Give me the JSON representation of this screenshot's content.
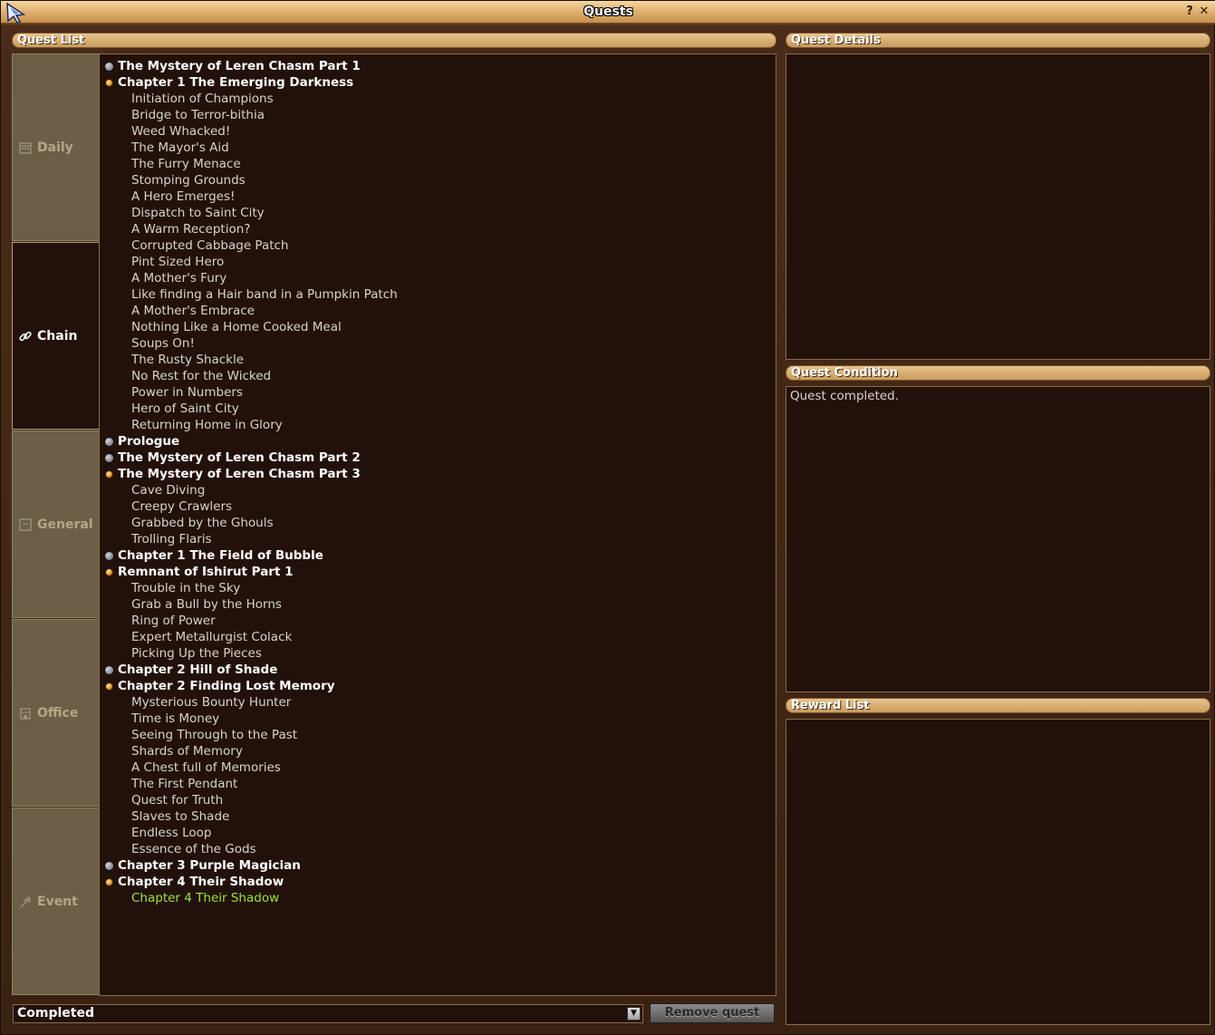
{
  "window": {
    "title": "Quests"
  },
  "sections": {
    "quest_list": "Quest List",
    "quest_details": "Quest Details",
    "quest_condition": "Quest Condition",
    "reward_list": "Reward List"
  },
  "tabs": [
    {
      "label": "Daily",
      "icon": "calendar-icon",
      "active": false
    },
    {
      "label": "Chain",
      "icon": "chain-link-icon",
      "active": true
    },
    {
      "label": "General",
      "icon": "square-icon",
      "active": false
    },
    {
      "label": "Office",
      "icon": "building-icon",
      "active": false
    },
    {
      "label": "Event",
      "icon": "flag-icon",
      "active": false
    }
  ],
  "quest_rows": [
    {
      "type": "group",
      "bullet": "grey",
      "text": "The Mystery of Leren Chasm Part 1"
    },
    {
      "type": "group",
      "bullet": "orange",
      "text": "Chapter 1 The Emerging Darkness"
    },
    {
      "type": "item",
      "text": "Initiation of Champions"
    },
    {
      "type": "item",
      "text": "Bridge to Terror-bithia"
    },
    {
      "type": "item",
      "text": "Weed Whacked!"
    },
    {
      "type": "item",
      "text": "The Mayor's Aid"
    },
    {
      "type": "item",
      "text": "The Furry Menace"
    },
    {
      "type": "item",
      "text": "Stomping Grounds"
    },
    {
      "type": "item",
      "text": "A Hero Emerges!"
    },
    {
      "type": "item",
      "text": "Dispatch to Saint City"
    },
    {
      "type": "item",
      "text": "A Warm Reception?"
    },
    {
      "type": "item",
      "text": "Corrupted Cabbage Patch"
    },
    {
      "type": "item",
      "text": "Pint Sized Hero"
    },
    {
      "type": "item",
      "text": "A Mother's Fury"
    },
    {
      "type": "item",
      "text": "Like finding a Hair band in a Pumpkin Patch"
    },
    {
      "type": "item",
      "text": "A Mother's Embrace"
    },
    {
      "type": "item",
      "text": "Nothing Like a Home Cooked Meal"
    },
    {
      "type": "item",
      "text": "Soups On!"
    },
    {
      "type": "item",
      "text": "The Rusty Shackle"
    },
    {
      "type": "item",
      "text": "No Rest for the Wicked"
    },
    {
      "type": "item",
      "text": "Power in Numbers"
    },
    {
      "type": "item",
      "text": "Hero of Saint City"
    },
    {
      "type": "item",
      "text": "Returning Home in Glory"
    },
    {
      "type": "group",
      "bullet": "grey",
      "text": "Prologue"
    },
    {
      "type": "group",
      "bullet": "grey",
      "text": "The Mystery of Leren Chasm Part 2"
    },
    {
      "type": "group",
      "bullet": "orange",
      "text": "The Mystery of Leren Chasm Part 3"
    },
    {
      "type": "item",
      "text": "Cave Diving"
    },
    {
      "type": "item",
      "text": "Creepy Crawlers"
    },
    {
      "type": "item",
      "text": "Grabbed by the Ghouls"
    },
    {
      "type": "item",
      "text": "Trolling Flaris"
    },
    {
      "type": "group",
      "bullet": "grey",
      "text": "Chapter 1 The Field of Bubble"
    },
    {
      "type": "group",
      "bullet": "orange",
      "text": "Remnant of Ishirut Part 1"
    },
    {
      "type": "item",
      "text": "Trouble in the Sky"
    },
    {
      "type": "item",
      "text": "Grab a Bull by the Horns"
    },
    {
      "type": "item",
      "text": "Ring of Power"
    },
    {
      "type": "item",
      "text": "Expert Metallurgist Colack"
    },
    {
      "type": "item",
      "text": "Picking Up the Pieces"
    },
    {
      "type": "group",
      "bullet": "grey",
      "text": "Chapter 2 Hill of Shade"
    },
    {
      "type": "group",
      "bullet": "orange",
      "text": "Chapter 2 Finding Lost Memory"
    },
    {
      "type": "item",
      "text": "Mysterious Bounty Hunter"
    },
    {
      "type": "item",
      "text": "Time is Money"
    },
    {
      "type": "item",
      "text": "Seeing Through to the Past"
    },
    {
      "type": "item",
      "text": "Shards of Memory"
    },
    {
      "type": "item",
      "text": "A Chest full of Memories"
    },
    {
      "type": "item",
      "text": "The First Pendant"
    },
    {
      "type": "item",
      "text": "Quest for Truth"
    },
    {
      "type": "item",
      "text": "Slaves to Shade"
    },
    {
      "type": "item",
      "text": "Endless Loop"
    },
    {
      "type": "item",
      "text": "Essence of the Gods"
    },
    {
      "type": "group",
      "bullet": "grey",
      "text": "Chapter 3 Purple Magician"
    },
    {
      "type": "group",
      "bullet": "orange",
      "text": "Chapter 4 Their Shadow"
    },
    {
      "type": "item",
      "text": "Chapter 4 Their Shadow",
      "highlight": true
    }
  ],
  "filter": {
    "selected": "Completed"
  },
  "buttons": {
    "remove_quest": "Remove quest"
  },
  "condition": {
    "text": "Quest completed."
  },
  "colors": {
    "panel_bg": "#22110a",
    "header_gold": "#d4a86a",
    "highlight_green": "#9be238"
  }
}
